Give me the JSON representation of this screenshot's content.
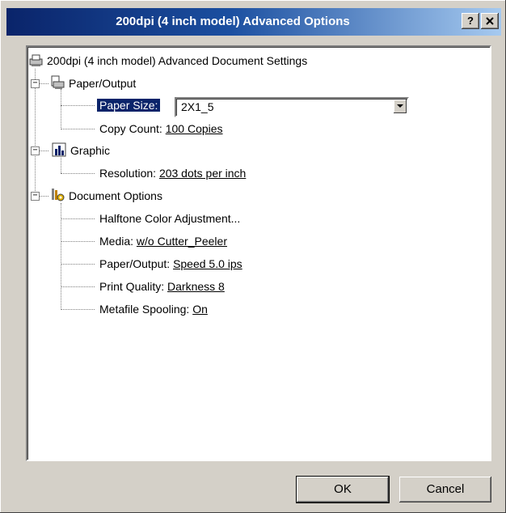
{
  "window": {
    "title": "200dpi (4 inch model) Advanced Options",
    "help_label": "?",
    "close_label": "✕"
  },
  "tree": {
    "root": "200dpi (4 inch model) Advanced Document Settings",
    "paper_output": {
      "label": "Paper/Output",
      "paper_size_label": "Paper Size:",
      "paper_size_value": "2X1_5",
      "copy_count_label": "Copy Count:",
      "copy_count_value": "100 Copies"
    },
    "graphic": {
      "label": "Graphic",
      "resolution_label": "Resolution:",
      "resolution_value": "203 dots per inch"
    },
    "document_options": {
      "label": "Document Options",
      "halftone": "Halftone Color Adjustment...",
      "media_label": "Media:",
      "media_value": "w/o Cutter_Peeler",
      "paper_output_label": "Paper/Output:",
      "paper_output_value": "Speed 5.0 ips",
      "print_quality_label": "Print Quality:",
      "print_quality_value": "Darkness 8",
      "metafile_label": "Metafile Spooling:",
      "metafile_value": "On"
    }
  },
  "buttons": {
    "ok": "OK",
    "cancel": "Cancel"
  },
  "colors": {
    "titlebar_start": "#0a246a",
    "titlebar_end": "#a6caf0",
    "face": "#d4d0c8",
    "selection": "#0a246a"
  },
  "icons": [
    "printer-icon",
    "paper-output-icon",
    "graphic-icon",
    "document-options-icon",
    "dropdown-arrow-icon"
  ]
}
